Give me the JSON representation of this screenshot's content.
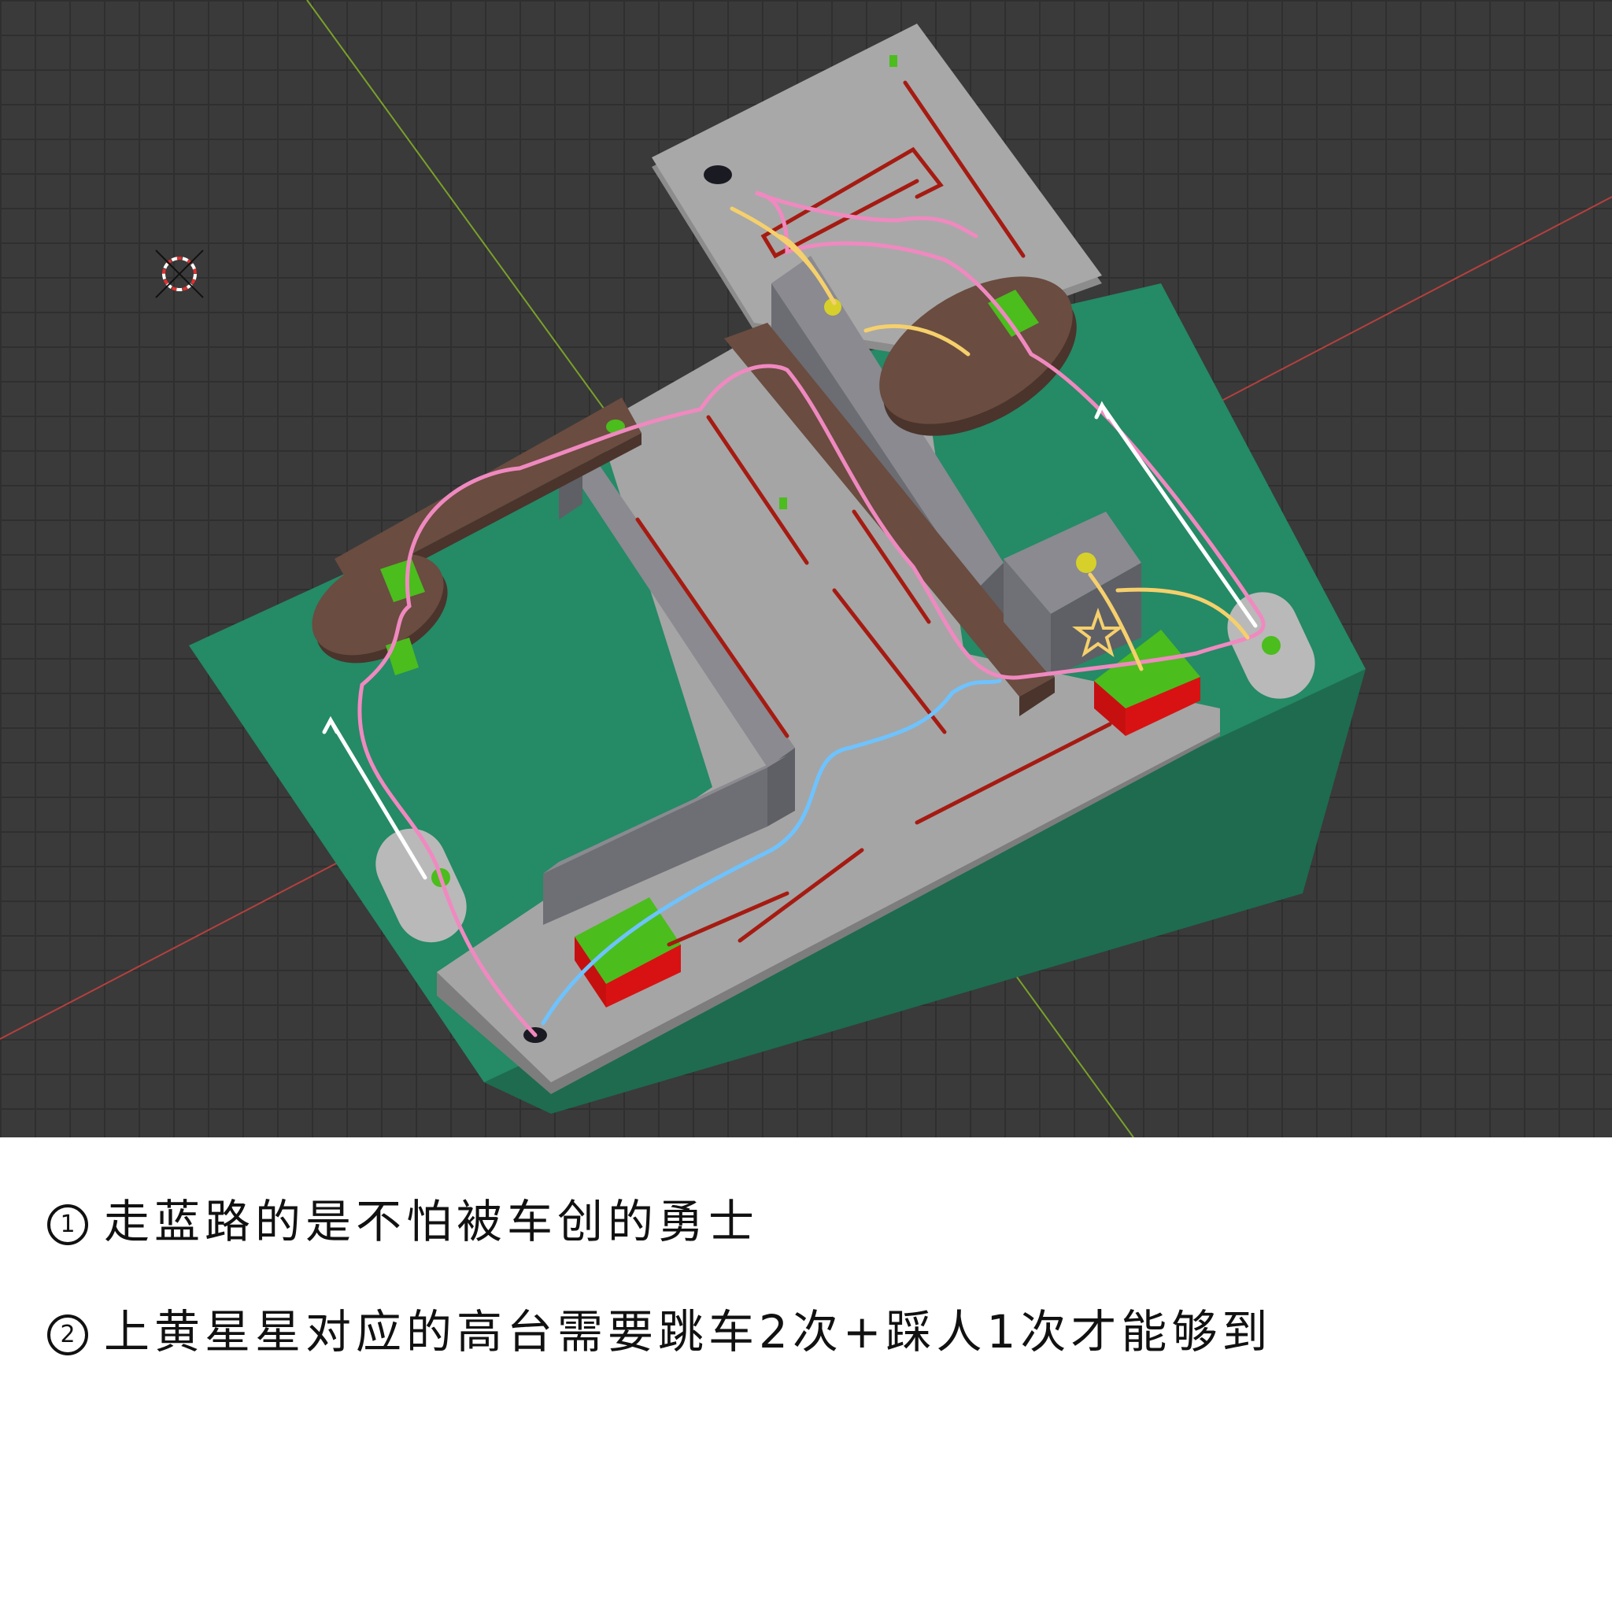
{
  "viewport": {
    "background": "#3a3a3a",
    "axes": {
      "x_color": "#b4403e",
      "y_color": "#7aa12a"
    },
    "cursor_icon": "3d-cursor-icon"
  },
  "legend_colors": {
    "blue_path": "#6ec3ff",
    "pink_path": "#f089c0",
    "yellow_path": "#f5d06c",
    "white_path": "#ffffff",
    "red_path": "#a51b12",
    "grass": "#258a66",
    "floor": "#a5a5a5",
    "wall": "#7a7a80",
    "wood": "#6a4c40",
    "box_top": "#4bbd1d",
    "box_side": "#d81212"
  },
  "icons": {
    "star": "star-icon",
    "goal_marker": "yellow-dot-icon",
    "spawn_hole": "hole-icon"
  },
  "notes": [
    {
      "number": "1",
      "text": "走蓝路的是不怕被车创的勇士"
    },
    {
      "number": "2",
      "text": "上黄星星对应的高台需要跳车2次+踩人1次才能够到"
    }
  ]
}
